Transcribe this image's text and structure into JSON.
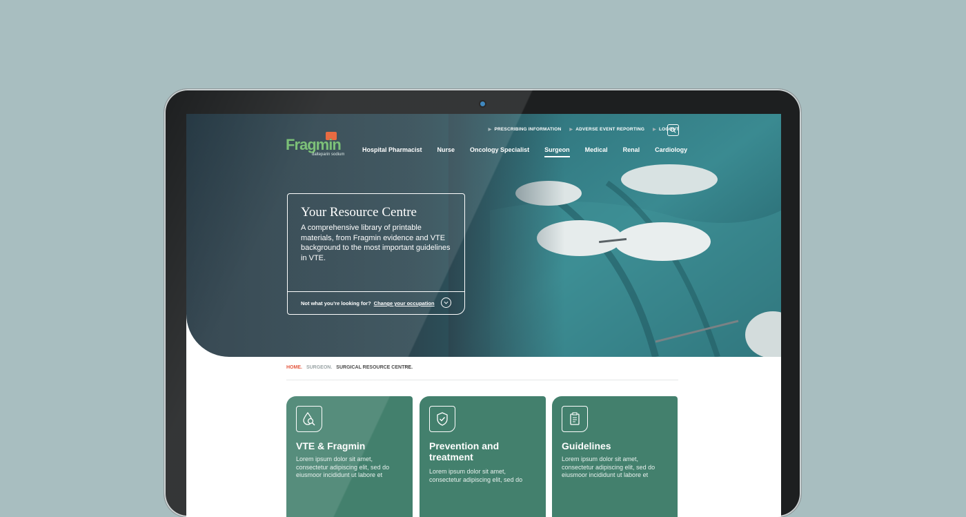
{
  "brand": {
    "name": "Fragmin",
    "sub": "dalteparin sodium"
  },
  "utility_links": [
    "PRESCRIBING INFORMATION",
    "ADVERSE EVENT REPORTING",
    "LOGOUT"
  ],
  "nav": {
    "items": [
      "Hospital Pharmacist",
      "Nurse",
      "Oncology Specialist",
      "Surgeon",
      "Medical",
      "Renal",
      "Cardiology"
    ],
    "active": "Surgeon"
  },
  "hero": {
    "title": "Your Resource Centre",
    "description": "A comprehensive library of printable materials, from Fragmin evidence and VTE background to the most important guidelines in VTE.",
    "footer_question": "Not what you’re looking for?",
    "footer_link": "Change your occupation"
  },
  "breadcrumb": [
    "HOME.",
    "SURGEON.",
    "SURGICAL RESOURCE CENTRE."
  ],
  "tiles": [
    {
      "title": "VTE & Fragmin",
      "icon": "drop-magnifier-icon",
      "body": "Lorem ipsum dolor sit amet, consectetur adipiscing elit, sed do eiusmoor incididunt ut labore et"
    },
    {
      "title": "Prevention and treatment",
      "icon": "shield-check-icon",
      "body": "Lorem ipsum dolor sit amet, consectetur adipiscing elit, sed do"
    },
    {
      "title": "Guidelines",
      "icon": "document-icon",
      "body": "Lorem ipsum dolor sit amet, consectetur adipiscing elit, sed do eiusmoor incididunt ut labore et"
    }
  ],
  "colors": {
    "background": "#a8bec0",
    "tile_green": "#43806d",
    "breadcrumb_home": "#e2462b",
    "hero_dark": "#223540"
  }
}
